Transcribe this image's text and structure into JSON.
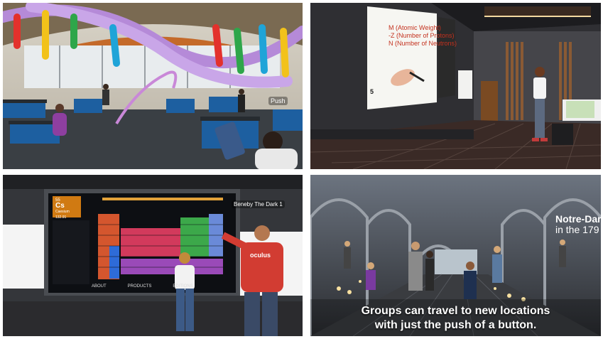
{
  "panels": [
    {
      "id": "dna-classroom",
      "tags": {
        "push": "Push"
      }
    },
    {
      "id": "lecture-hall",
      "board": {
        "line1": "M (Atomic Weight)",
        "line2": "-Z (Number of Protons)",
        "line3": "N (Number of Neutrons)",
        "bullet": "5"
      }
    },
    {
      "id": "periodic-table",
      "element": {
        "number": "55",
        "symbol": "Cs",
        "name": "Caesium",
        "mass": "132.91"
      },
      "menu": [
        "ABOUT",
        "PRODUCTS",
        "EDITIONS"
      ],
      "user": "Beneby The Dark 1",
      "shirt": "oculus"
    },
    {
      "id": "cathedral",
      "title_line1": "Notre-Dam",
      "title_line2": "in the 179",
      "caption_line1": "Groups can travel to new locations",
      "caption_line2": "with just the push of a button."
    }
  ],
  "colors": {
    "accent": "#2a8fd6"
  }
}
